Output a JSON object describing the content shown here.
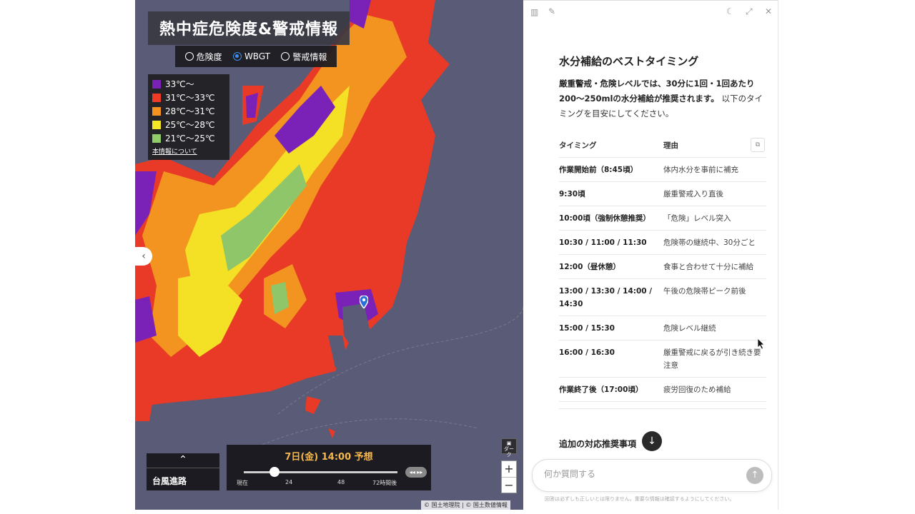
{
  "map": {
    "title": "熱中症危険度&警戒情報",
    "modes": [
      {
        "label": "危険度",
        "selected": false
      },
      {
        "label": "WBGT",
        "selected": true
      },
      {
        "label": "警戒情報",
        "selected": false
      }
    ],
    "legend": [
      {
        "label": "33℃〜",
        "color": "#7a22b8"
      },
      {
        "label": "31℃〜33℃",
        "color": "#ef3b25"
      },
      {
        "label": "28℃〜31℃",
        "color": "#f6921e"
      },
      {
        "label": "25℃〜28℃",
        "color": "#f6e626"
      },
      {
        "label": "21℃〜25℃",
        "color": "#90cc6a"
      }
    ],
    "legend_link": "本情報について",
    "typhoon_label": "台風進路",
    "timeline": {
      "title": "7日(金) 14:00 予想",
      "ticks": [
        "現在",
        "24",
        "48",
        "72時間後"
      ],
      "progress": 0.2
    },
    "dark_label": "ダーク",
    "zoom_in": "+",
    "zoom_out": "−",
    "attribution": "© 国土地理院 | © 国土数値情報"
  },
  "panel": {
    "section_title": "水分補給のベストタイミング",
    "intro_bold": "厳重警戒・危険レベルでは、30分に1回・1回あたり200〜250mlの水分補給が推奨されます。",
    "intro_rest": "以下のタイミングを目安にしてください。",
    "table": {
      "headers": [
        "タイミング",
        "理由"
      ],
      "rows": [
        [
          "作業開始前（8:45頃）",
          "体内水分を事前に補充"
        ],
        [
          "9:30頃",
          "厳重警戒入り直後"
        ],
        [
          "10:00頃（強制休憩推奨）",
          "「危険」レベル突入"
        ],
        [
          "10:30 / 11:00 / 11:30",
          "危険帯の継続中、30分ごと"
        ],
        [
          "12:00（昼休憩）",
          "食事と合わせて十分に補給"
        ],
        [
          "13:00 / 13:30 / 14:00 / 14:30",
          "午後の危険帯ピーク前後"
        ],
        [
          "15:00 / 15:30",
          "危険レベル継続"
        ],
        [
          "16:00 / 16:30",
          "厳重警戒に戻るが引き続き要注意"
        ],
        [
          "作業終了後（17:00頃）",
          "疲労回復のため補給"
        ]
      ]
    },
    "next_section": "追加の対応推奨事項",
    "input_placeholder": "何か質問する",
    "disclaimer": "回答は必ずしも正しいとは限りません。重要な情報は確認するようにしてください。"
  }
}
